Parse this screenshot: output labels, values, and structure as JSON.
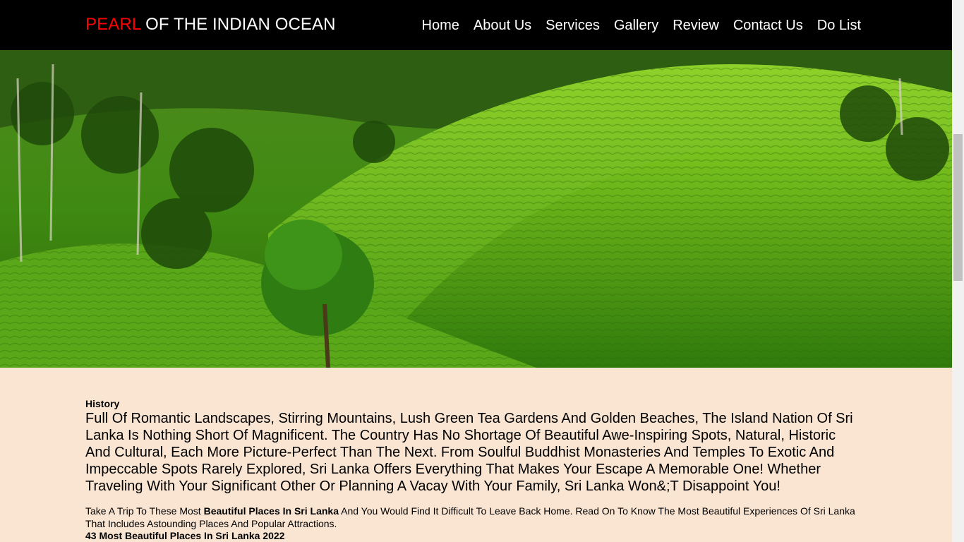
{
  "brand": {
    "accent": "PEARL",
    "rest": "OF THE INDIAN OCEAN",
    "accent_color": "#ff0000"
  },
  "nav": {
    "items": [
      {
        "label": "Home"
      },
      {
        "label": "About Us"
      },
      {
        "label": "Services"
      },
      {
        "label": "Gallery"
      },
      {
        "label": "Review"
      },
      {
        "label": "Contact Us"
      },
      {
        "label": "Do List"
      }
    ]
  },
  "hero": {
    "image": "tea-plantation-hills"
  },
  "main": {
    "heading": "History",
    "lead": "Full Of Romantic Landscapes, Stirring Mountains, Lush Green Tea Gardens And Golden Beaches, The Island Nation Of Sri Lanka Is Nothing Short Of Magnificent. The Country Has No Shortage Of Beautiful Awe-Inspiring Spots, Natural, Historic And Cultural, Each More Picture-Perfect Than The Next. From Soulful Buddhist Monasteries And Temples To Exotic And Impeccable Spots Rarely Explored, Sri Lanka Offers Everything That Makes Your Escape A Memorable One! Whether Traveling With Your Significant Other Or Planning A Vacay With Your Family, Sri Lanka Won&;T Disappoint You!",
    "para_pre": "Take A Trip To These Most ",
    "para_bold": "Beautiful Places In Sri Lanka",
    "para_post": " And You Would Find It Difficult To Leave Back Home. Read On To Know The Most Beautiful Experiences Of Sri Lanka That Includes Astounding Places And Popular Attractions.",
    "subheading": "43 Most Beautiful Places In Sri Lanka 2022"
  },
  "colors": {
    "navbar": "#000000",
    "page_bg": "#fae5d2"
  }
}
